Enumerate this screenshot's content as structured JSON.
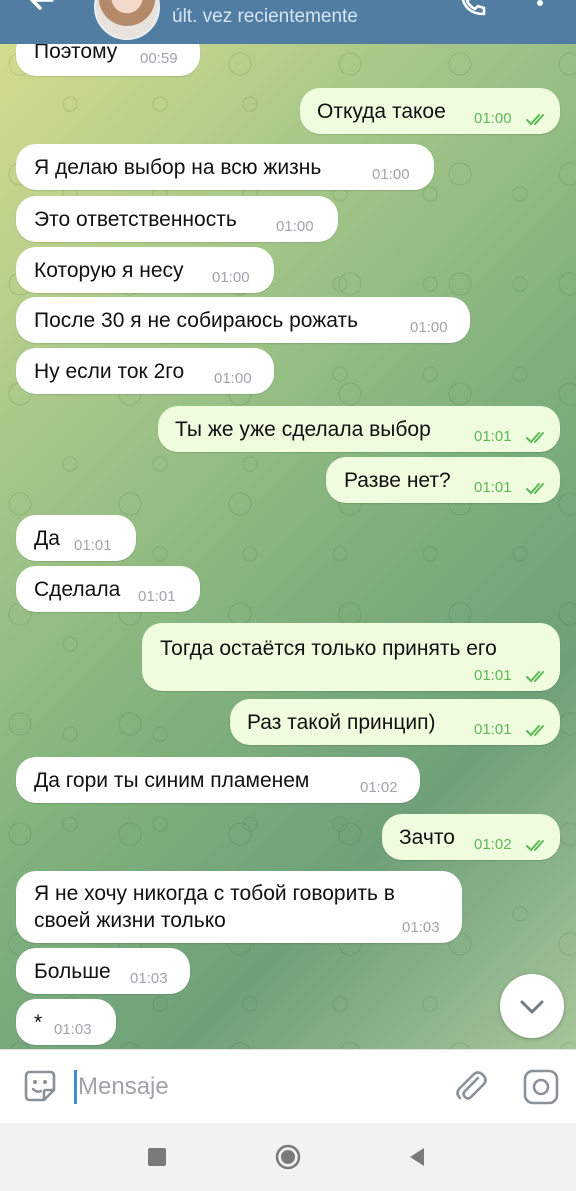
{
  "header": {
    "title": "",
    "status": "últ. vez recientemente",
    "back_icon": "arrow-left-icon",
    "call_icon": "phone-icon",
    "menu_icon": "more-vert-icon"
  },
  "messages": [
    {
      "dir": "in",
      "text": "Поэтому",
      "time": "00:59"
    },
    {
      "dir": "out",
      "text": "Откуда такое",
      "time": "01:00"
    },
    {
      "dir": "in",
      "text": "Я делаю выбор на всю жизнь",
      "time": "01:00"
    },
    {
      "dir": "in",
      "text": "Это ответственность",
      "time": "01:00"
    },
    {
      "dir": "in",
      "text": "Которую я несу",
      "time": "01:00"
    },
    {
      "dir": "in",
      "text": "После 30 я не собираюсь рожать",
      "time": "01:00"
    },
    {
      "dir": "in",
      "text": "Ну если ток 2го",
      "time": "01:00"
    },
    {
      "dir": "out",
      "text": "Ты же уже сделала выбор",
      "time": "01:01"
    },
    {
      "dir": "out",
      "text": "Разве нет?",
      "time": "01:01"
    },
    {
      "dir": "in",
      "text": "Да",
      "time": "01:01"
    },
    {
      "dir": "in",
      "text": "Сделала",
      "time": "01:01"
    },
    {
      "dir": "out",
      "text": "Тогда остаётся только принять его",
      "time": "01:01"
    },
    {
      "dir": "out",
      "text": "Раз такой принцип)",
      "time": "01:01"
    },
    {
      "dir": "in",
      "text": "Да гори ты синим пламенем",
      "time": "01:02"
    },
    {
      "dir": "out",
      "text": "Зачто",
      "time": "01:02"
    },
    {
      "dir": "in",
      "text_line1": "Я не хочу никогда с тобой говорить в",
      "text_line2": "своей жизни только",
      "time": "01:03"
    },
    {
      "dir": "in",
      "text": "Больше",
      "time": "01:03"
    },
    {
      "dir": "in",
      "text": "*",
      "time": "01:03"
    }
  ],
  "composer": {
    "placeholder": "Mensaje",
    "emoji_icon": "sticker-smile-icon",
    "attach_icon": "paperclip-icon",
    "camera_icon": "camera-icon"
  },
  "scroll_icon": "chevron-down-icon",
  "nav": {
    "recent_icon": "recent-apps-icon",
    "home_icon": "home-circle-icon",
    "back_icon": "back-triangle-icon"
  },
  "colors": {
    "header": "#517da2",
    "incoming_bubble": "#ffffff",
    "outgoing_bubble": "#effdde",
    "outgoing_time": "#5eb756",
    "incoming_time": "#a0a5ab"
  }
}
